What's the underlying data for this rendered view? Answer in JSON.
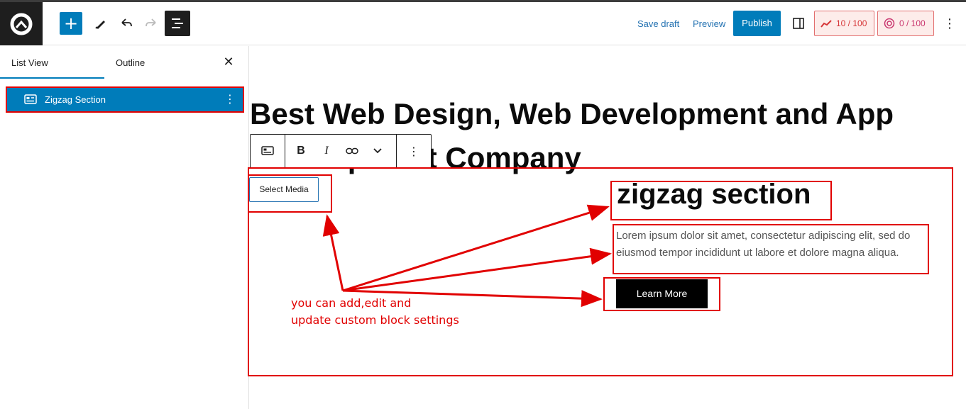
{
  "header": {
    "save_draft": "Save draft",
    "preview": "Preview",
    "publish": "Publish",
    "score_seo": "10 / 100",
    "score_ai": "0 / 100",
    "icons": [
      "wordpress-logo-icon",
      "plus-icon",
      "pen-icon",
      "undo-icon",
      "redo-icon",
      "list-view-icon",
      "sidebar-toggle-icon",
      "more-vertical-icon"
    ]
  },
  "sidebar": {
    "tabs": [
      "List View",
      "Outline"
    ],
    "active_tab": "List View",
    "items": [
      {
        "label": "Zigzag Section",
        "icon": "block-icon"
      }
    ]
  },
  "canvas": {
    "heading": "Best Web Design, Web Development and App Development Company",
    "heading_visible": "Best Web Design, Web Development and\n      pp Development Company",
    "select_media": "Select Media",
    "zigzag_title": "zigzag section",
    "zigzag_text": "Lorem ipsum dolor sit amet, consectetur adipiscing elit, sed do eiusmod tempor incididunt ut labore et dolore magna aliqua.",
    "button_label": "Learn More",
    "annotation": "you can add,edit and\nupdate custom block settings"
  },
  "colors": {
    "accent": "#007cba",
    "annotation_red": "#e10000",
    "dark": "#1e1e1e"
  }
}
